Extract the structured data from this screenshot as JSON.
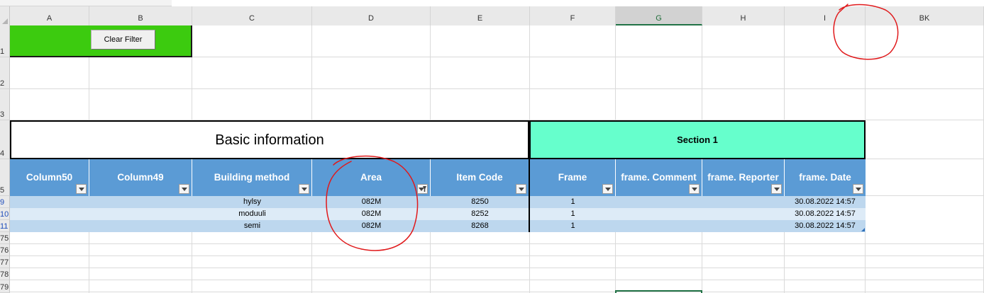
{
  "columns": [
    "A",
    "B",
    "C",
    "D",
    "E",
    "F",
    "G",
    "H",
    "I",
    "BK"
  ],
  "rows": [
    "1",
    "2",
    "3",
    "4",
    "5",
    "9",
    "10",
    "11",
    "75",
    "76",
    "77",
    "78",
    "79"
  ],
  "filter": {
    "clear_label": "Clear Filter"
  },
  "bands": {
    "basic": "Basic information",
    "section": "Section 1"
  },
  "headers": [
    "Column50",
    "Column49",
    "Building method",
    "Area",
    "Item Code",
    "Frame",
    "frame. Comment",
    "frame. Reporter",
    "frame. Date"
  ],
  "data": [
    [
      "",
      "",
      "hylsy",
      "082M",
      "8250",
      "1",
      "",
      "",
      "30.08.2022 14:57"
    ],
    [
      "",
      "",
      "moduuli",
      "082M",
      "8252",
      "1",
      "",
      "",
      "30.08.2022 14:57"
    ],
    [
      "",
      "",
      "semi",
      "082M",
      "8268",
      "1",
      "",
      "",
      "30.08.2022 14:57"
    ]
  ],
  "colors": {
    "green": "#3ccb0f",
    "section": "#66ffcc",
    "header": "#5b9bd5",
    "band1": "#bdd7ee",
    "band2": "#ddebf7",
    "annotation": "#e0191b"
  }
}
